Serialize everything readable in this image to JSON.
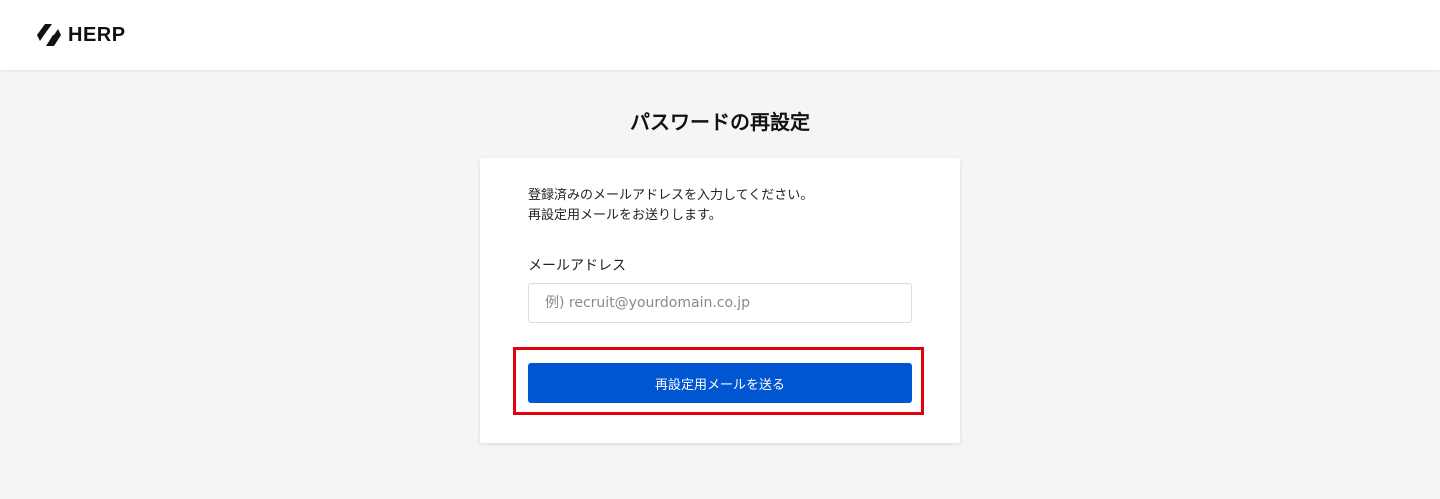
{
  "header": {
    "brand_name": "HERP",
    "logo_icon": "herp-logo-icon"
  },
  "page": {
    "title": "パスワードの再設定"
  },
  "form": {
    "description_line1": "登録済みのメールアドレスを入力してください。",
    "description_line2": "再設定用メールをお送りします。",
    "email_label": "メールアドレス",
    "email_value": "",
    "email_placeholder": "例) recruit@yourdomain.co.jp",
    "submit_label": "再設定用メールを送る"
  },
  "colors": {
    "primary_button": "#0055d0",
    "highlight_border": "#e3000f",
    "background": "#f5f5f5"
  }
}
